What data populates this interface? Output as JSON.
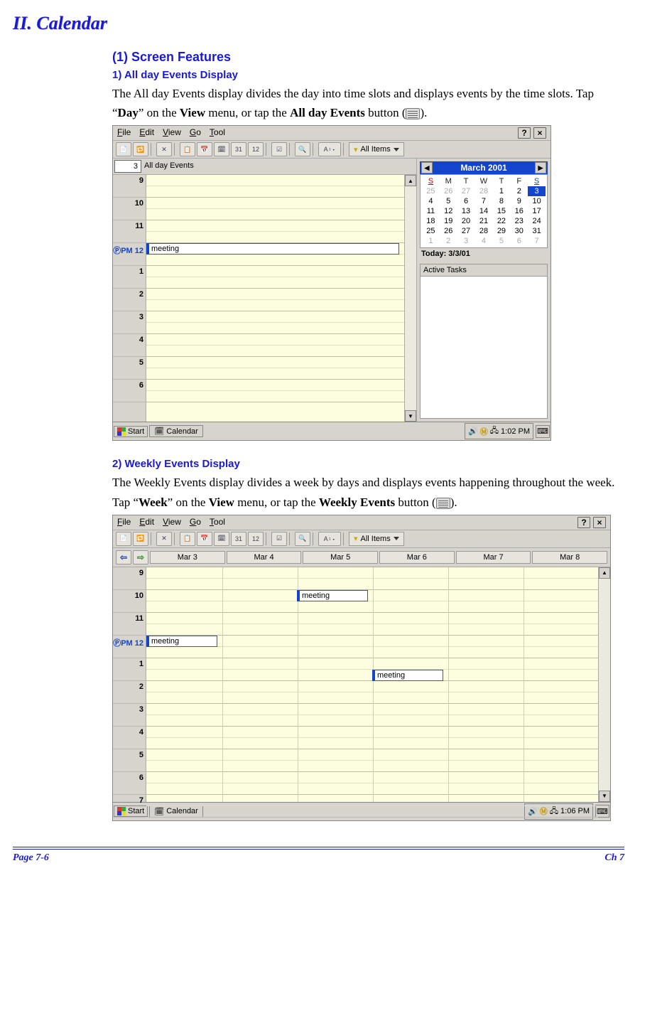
{
  "headings": {
    "h1": "II.   Calendar",
    "h2": "(1)  Screen Features",
    "h3a": "1)   All day Events Display",
    "h3b": "2)   Weekly Events Display"
  },
  "para1_a": "The All day Events display divides the day into time slots and displays events by the time slots. Tap “",
  "para1_b": "Day",
  "para1_c": "” on the ",
  "para1_d": "View",
  "para1_e": " menu, or tap the ",
  "para1_f": "All day Events",
  "para1_g": " button (",
  "para1_h": ").",
  "para2_a": "The Weekly Events display divides a week by days and displays events happening throughout the week. Tap “",
  "para2_b": "Week",
  "para2_c": "” on the ",
  "para2_d": "View",
  "para2_e": " menu, or tap the ",
  "para2_f": "Weekly Events",
  "para2_g": " button (",
  "para2_h": ").",
  "menu": {
    "file": "File",
    "edit": "Edit",
    "view": "View",
    "go": "Go",
    "tool": "Tool",
    "help": "?",
    "close": "×"
  },
  "toolbar": {
    "allitems": "All Items",
    "funnel": "▼"
  },
  "shotA": {
    "date": "3",
    "alldaylabel": "All day Events",
    "hours": [
      "9",
      "10",
      "11",
      "12",
      "1",
      "2",
      "3",
      "4",
      "5",
      "6"
    ],
    "pmLabel": "ⓅPM",
    "event": "meeting",
    "monthTitle": "March 2001",
    "dow": [
      "S",
      "M",
      "T",
      "W",
      "T",
      "F",
      "S"
    ],
    "weeks": [
      [
        {
          "d": "25",
          "c": "prev"
        },
        {
          "d": "26",
          "c": "prev"
        },
        {
          "d": "27",
          "c": "prev"
        },
        {
          "d": "28",
          "c": "prev"
        },
        {
          "d": "1"
        },
        {
          "d": "2"
        },
        {
          "d": "3",
          "c": "sel"
        }
      ],
      [
        {
          "d": "4"
        },
        {
          "d": "5"
        },
        {
          "d": "6"
        },
        {
          "d": "7"
        },
        {
          "d": "8"
        },
        {
          "d": "9"
        },
        {
          "d": "10"
        }
      ],
      [
        {
          "d": "11"
        },
        {
          "d": "12"
        },
        {
          "d": "13"
        },
        {
          "d": "14"
        },
        {
          "d": "15"
        },
        {
          "d": "16"
        },
        {
          "d": "17"
        }
      ],
      [
        {
          "d": "18"
        },
        {
          "d": "19"
        },
        {
          "d": "20"
        },
        {
          "d": "21"
        },
        {
          "d": "22"
        },
        {
          "d": "23"
        },
        {
          "d": "24"
        }
      ],
      [
        {
          "d": "25"
        },
        {
          "d": "26"
        },
        {
          "d": "27"
        },
        {
          "d": "28"
        },
        {
          "d": "29"
        },
        {
          "d": "30"
        },
        {
          "d": "31"
        }
      ],
      [
        {
          "d": "1",
          "c": "next"
        },
        {
          "d": "2",
          "c": "next"
        },
        {
          "d": "3",
          "c": "next"
        },
        {
          "d": "4",
          "c": "next"
        },
        {
          "d": "5",
          "c": "next"
        },
        {
          "d": "6",
          "c": "next"
        },
        {
          "d": "7",
          "c": "next"
        }
      ]
    ],
    "today": "Today: 3/3/01",
    "tasks": "Active Tasks",
    "start": "Start",
    "taskapp": "Calendar",
    "time": "1:02 PM"
  },
  "shotB": {
    "days": [
      "Mar 3",
      "Mar 4",
      "Mar 5",
      "Mar 6",
      "Mar 7",
      "Mar 8"
    ],
    "hours": [
      "9",
      "10",
      "11",
      "12",
      "1",
      "2",
      "3",
      "4",
      "5",
      "6",
      "7"
    ],
    "pmLabel": "ⓅPM",
    "events": [
      {
        "day": 0,
        "hour": 3,
        "half": 0,
        "text": "meeting"
      },
      {
        "day": 2,
        "hour": 1,
        "half": 0,
        "text": "meeting"
      },
      {
        "day": 3,
        "hour": 4,
        "half": 1,
        "text": "meeting"
      }
    ],
    "start": "Start",
    "taskapp": "Calendar",
    "time": "1:06 PM"
  },
  "footer": {
    "left": "Page 7-6",
    "right": "Ch 7"
  }
}
